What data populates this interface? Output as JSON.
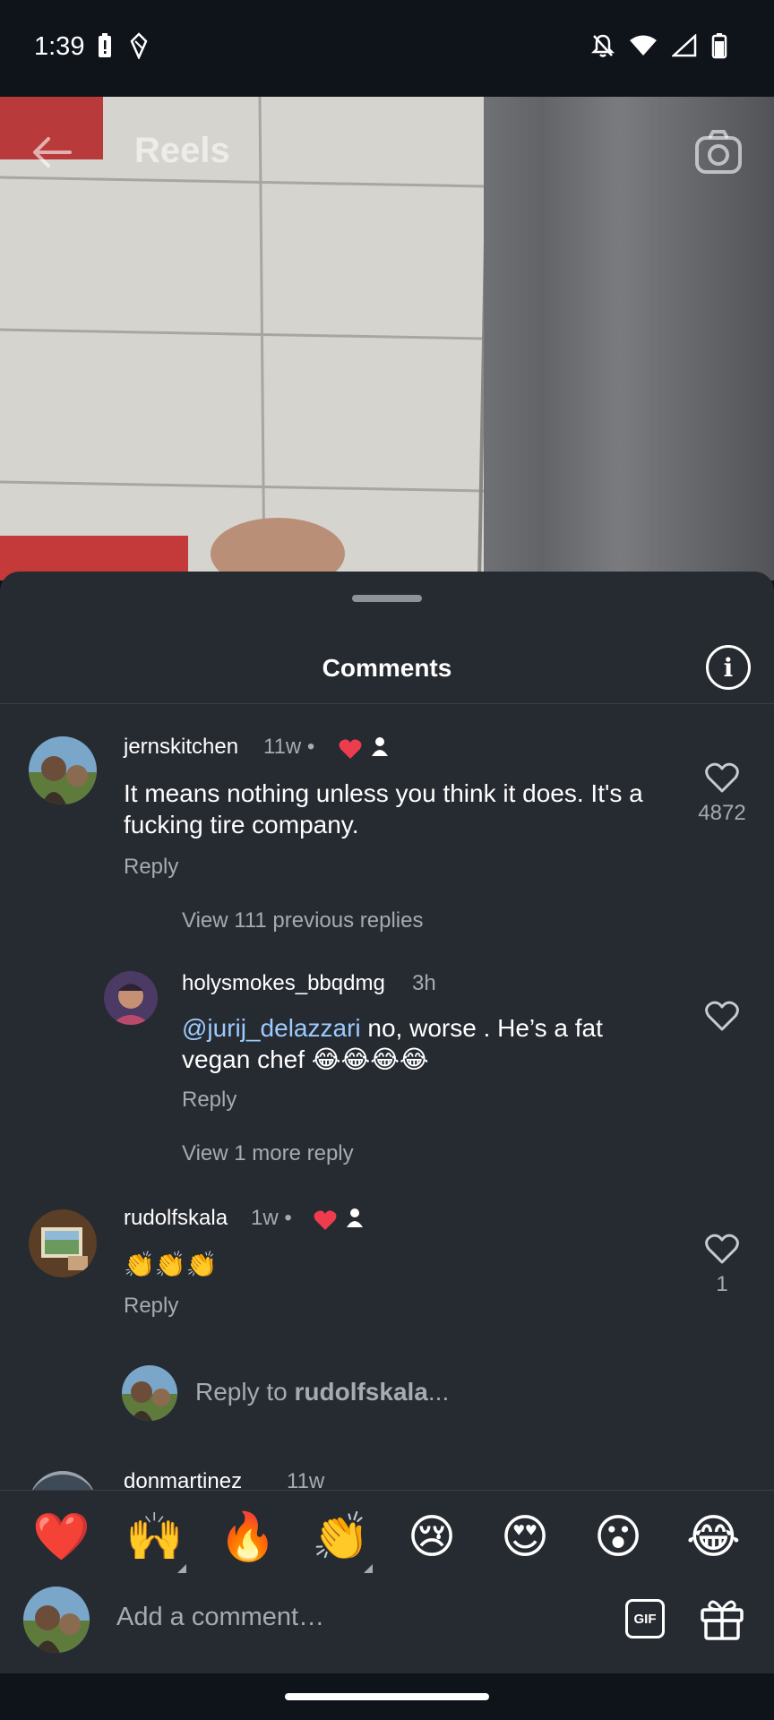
{
  "status_bar": {
    "time": "1:39"
  },
  "header": {
    "title": "Reels"
  },
  "sheet": {
    "title": "Comments"
  },
  "comments": [
    {
      "username": "jernskitchen",
      "meta": "11w •",
      "text": "It means nothing unless you think it does. It's a fucking tire company.",
      "reply_label": "Reply",
      "like_count": "4872"
    },
    {
      "view_replies_label": "View 111 previous replies"
    },
    {
      "username": "holysmokes_bbqdmg",
      "meta": "3h",
      "mention": "@jurij_delazzari",
      "text": " no, worse . He’s a fat vegan chef 😂😂😂😂",
      "reply_label": "Reply",
      "view_more_label": "View 1 more reply"
    },
    {
      "username": "rudolfskala",
      "meta": "1w •",
      "text": "👏👏👏",
      "reply_label": "Reply",
      "like_count": "1"
    },
    {
      "username": "donmartinez",
      "meta": "11w"
    }
  ],
  "reply_box": {
    "prefix": "Reply to ",
    "target": "rudolfskala",
    "suffix": "..."
  },
  "emoji_bar": [
    "❤️",
    "🙌",
    "🔥",
    "👏",
    "😢",
    "😍",
    "😮",
    "😂"
  ],
  "composer": {
    "placeholder": "Add a comment…",
    "gif_label": "GIF"
  },
  "colors": {
    "sheet_bg": "#262a31",
    "mention": "#9ccbff",
    "heart_red": "#ed3c4e"
  }
}
